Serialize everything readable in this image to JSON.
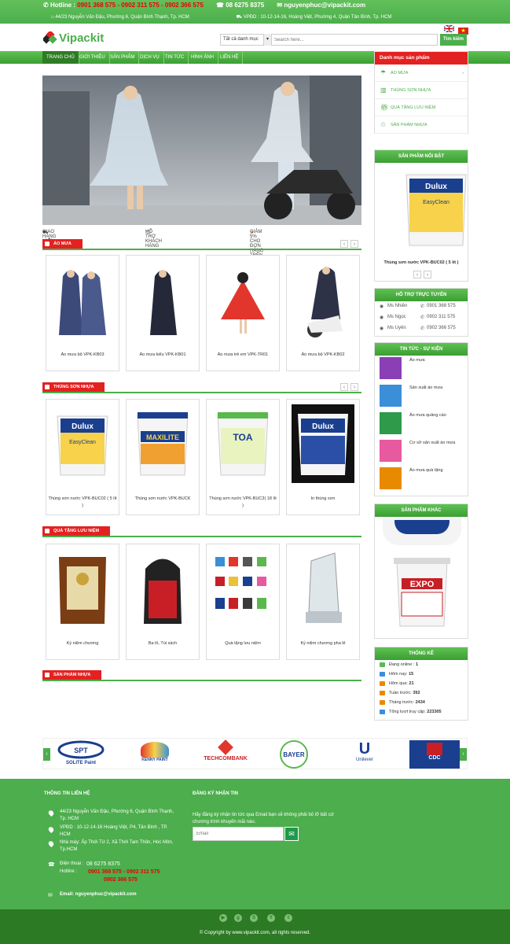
{
  "topbar": {
    "hotline_label": "Hotline :",
    "hotline_numbers": "0901 368 575 - 0902 311 575 - 0902 366 575",
    "phone": "08 6275 8375",
    "email": "nguyenphuc@vipackit.com",
    "address1": "44/23 Nguyễn Văn Đậu, Phường 6, Quận Bình Thạnh, Tp. HCM",
    "address2": "VPĐD : 10-12-14-16, Hoàng Việt, Phường 4, Quận Tân Bình, Tp. HCM"
  },
  "logo": {
    "text": "Vipackit"
  },
  "search": {
    "category": "Tất cả danh mục",
    "placeholder": "Search here...",
    "button": "Tìm kiếm"
  },
  "nav": [
    "TRANG CHỦ",
    "GIỚI THIỆU",
    "SẢN PHẨM",
    "DỊCH VỤ",
    "TIN TỨC",
    "HÌNH ẢNH",
    "LIÊN HỆ"
  ],
  "categories": {
    "title": "Danh mục sản phẩm",
    "items": [
      "ÁO MƯA",
      "THÙNG SƠN NHỰA",
      "QUÀ TẶNG LƯU NIỆM",
      "SẢN PHẨM NHỰA"
    ]
  },
  "features": [
    "GIAO HÀNG MIỄN PHÍ",
    "HỖ TRỢ KHÁCH HÀNG",
    "GIẢM 5% CHO ĐƠN HÀNG TRÊN 50 CHIẾC"
  ],
  "sections": [
    {
      "title": "ÁO MƯA",
      "products": [
        "Áo mưa bộ VPK-KB03",
        "Áo mưa kiểu VPK-KB01",
        "Áo mưa trẻ em VPK-TR01",
        "Áo mưa bộ VPK-KB02"
      ]
    },
    {
      "title": "THÙNG SƠN NHỰA",
      "products": [
        "Thùng sơn nước VPK-BUC02 ( 5 lít )",
        "Thùng sơn nước VPK-BUCK",
        "Thùng sơn nước VPK-BUC3( 18 lít )",
        "In thùng sơn"
      ]
    },
    {
      "title": "QUÀ TẶNG LƯU NIỆM",
      "products": [
        "Kỷ niệm chương",
        "Ba lô, Túi xách",
        "Quà tặng lưu niệm",
        "Kỷ niệm chương pha lê"
      ]
    },
    {
      "title": "SẢN PHẨM NHỰA",
      "products": []
    }
  ],
  "featured": {
    "title": "SẢN PHẨM NỔI BẬT",
    "item": "Thùng sơn nước VPK-BUC02 ( 5 lít )"
  },
  "support": {
    "title": "HỖ TRỢ TRỰC TUYẾN",
    "people": [
      {
        "name": "Ms Nhiên",
        "phone": "0901 368 575"
      },
      {
        "name": "Ms Ngọc",
        "phone": "0902 311 575"
      },
      {
        "name": "Ms Uyên",
        "phone": "0902 366 575"
      }
    ]
  },
  "news": {
    "title": "TIN TỨC - SỰ KIỆN",
    "items": [
      "Áo mưa",
      "Sản xuất áo mưa",
      "Áo mưa quảng cáo",
      "Cơ sở sản xuất áo mưa",
      "Áo mưa quà tặng"
    ]
  },
  "other": {
    "title": "SẢN PHẨM KHÁC"
  },
  "stats": {
    "title": "THỐNG KÊ",
    "rows": [
      {
        "label": "Đang online :",
        "value": "1"
      },
      {
        "label": "Hôm nay:",
        "value": "15"
      },
      {
        "label": "Hôm qua:",
        "value": "21"
      },
      {
        "label": "Tuần trước:",
        "value": "392"
      },
      {
        "label": "Tháng trước:",
        "value": "2434"
      },
      {
        "label": "Tổng lượt truy cập:",
        "value": "223305"
      }
    ]
  },
  "partners": [
    "SOLITE Paint",
    "KENNY PAINT",
    "TECHCOMBANK",
    "BAYER",
    "Unilever",
    "CDC"
  ],
  "footer": {
    "contact_title": "THÔNG TIN LIÊN HỆ",
    "addr1": "44/23 Nguyễn Văn Đậu, Phường 6, Quận Bình Thạnh, Tp. HCM",
    "addr2": "VPĐD : 10-12-14-16 Hoàng Việt, P4, Tân Bình , TP. HCM",
    "addr3": "Nhà máy: Ấp Thới Tứ 2, Xã Thới Tam Thôn, Hóc Môn, Tp.HCM",
    "phone_label": "Điện thoại :",
    "phone": "08 6275 8375",
    "hotline_label": "Hotline :",
    "hotline1": "0901 368 575 - 0902 311 575",
    "hotline2": "0902 366 575",
    "email": "Email: nguyenphuc@vipackit.com",
    "newsletter_title": "ĐĂNG KÝ NHẬN TIN",
    "newsletter_text": "Hãy đăng ký nhận tin tức qua Email bạn sẽ không phải bỏ lỡ bất cứ chương trình khuyến mãi nào.",
    "email_placeholder": "Email",
    "copyright": "© Copyright by  www.vipackit.com, all rights reserved."
  }
}
